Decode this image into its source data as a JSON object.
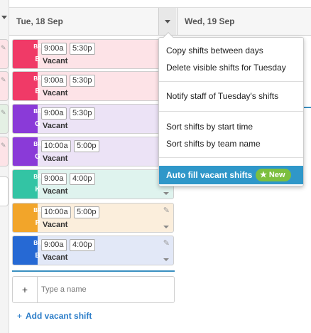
{
  "header": {
    "days": [
      "Tue, 18 Sep",
      "Wed, 19 Sep"
    ]
  },
  "shifts": [
    {
      "team_code": "BR",
      "team_letter": "B",
      "start": "9:00a",
      "end": "5:30p",
      "status": "Vacant",
      "team_color": "#f03a67",
      "bg_color": "#fde3e7"
    },
    {
      "team_code": "BR",
      "team_letter": "B",
      "start": "9:00a",
      "end": "5:30p",
      "status": "Vacant",
      "team_color": "#f03a67",
      "bg_color": "#fde3e7"
    },
    {
      "team_code": "BR",
      "team_letter": "G",
      "start": "9:00a",
      "end": "5:30p",
      "status": "Vacant",
      "team_color": "#8a3ad8",
      "bg_color": "#ece3f6"
    },
    {
      "team_code": "BR",
      "team_letter": "G",
      "start": "10:00a",
      "end": "5:00p",
      "status": "Vacant",
      "team_color": "#8a3ad8",
      "bg_color": "#ece3f6"
    },
    {
      "team_code": "BR",
      "team_letter": "K",
      "start": "9:00a",
      "end": "4:00p",
      "status": "Vacant",
      "team_color": "#33c4a4",
      "bg_color": "#dff3ee"
    },
    {
      "team_code": "BR",
      "team_letter": "P",
      "start": "10:00a",
      "end": "5:00p",
      "status": "Vacant",
      "team_color": "#f2a52a",
      "bg_color": "#fbeedc"
    },
    {
      "team_code": "BR",
      "team_letter": "B",
      "start": "9:00a",
      "end": "4:00p",
      "status": "Vacant",
      "team_color": "#2669d4",
      "bg_color": "#e2e8f7"
    }
  ],
  "add_row": {
    "plus": "+",
    "name_placeholder": "Type a name"
  },
  "add_vacant": {
    "plus": "+",
    "label": "Add vacant shift"
  },
  "menu": {
    "items": [
      "Copy shifts between days",
      "Delete visible shifts for Tuesday",
      "Notify staff of Tuesday's shifts",
      "Sort shifts by start time",
      "Sort shifts by team name",
      "Auto fill vacant shifts"
    ],
    "badge": "★ New"
  },
  "colors": {
    "accent": "#2f97c9",
    "link": "#2a7cc8",
    "badge": "#7cbf3f"
  }
}
